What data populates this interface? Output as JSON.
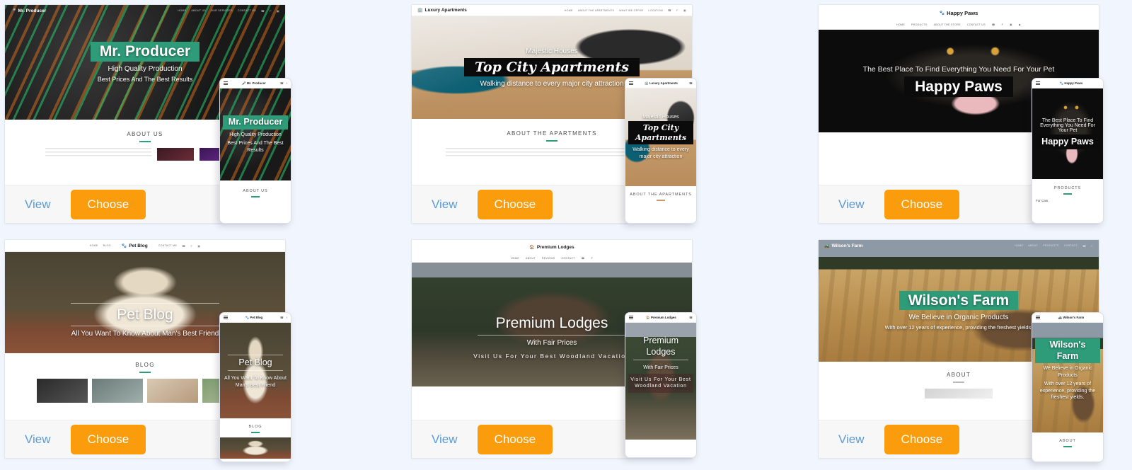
{
  "page": {
    "background": "#f1f5fd",
    "accent": "#fb9c0c",
    "link": "#5b9bd5",
    "brand_green": "#2e9c78"
  },
  "actions": {
    "view_label": "View",
    "choose_label": "Choose"
  },
  "templates": [
    {
      "id": "mr-producer",
      "brand": "Mr. Producer",
      "brand_icon": "microphone-icon",
      "nav": [
        "HOME",
        "ABOUT US",
        "OUR SERVICES",
        "CONTACT US"
      ],
      "social": [
        "phone-icon",
        "facebook-icon",
        "instagram-icon"
      ],
      "hero": {
        "pre": "",
        "title": "Mr. Producer",
        "sub": "High Quality Production",
        "sub2": "Best Prices And The Best Results"
      },
      "section_title": "ABOUT US",
      "phone_section_title": "ABOUT US",
      "phone_footnote": ""
    },
    {
      "id": "luxury-apartments",
      "brand": "Luxury Apartments",
      "brand_icon": "building-icon",
      "nav": [
        "HOME",
        "ABOUT THE APARTMENTS",
        "WHAT WE OFFER",
        "LOCATION"
      ],
      "social": [
        "phone-icon",
        "facebook-icon",
        "instagram-icon"
      ],
      "hero": {
        "pre": "Majestic Houses",
        "title": "Top City Apartments",
        "sub": "Walking distance to every major city attraction",
        "sub2": ""
      },
      "section_title": "ABOUT THE APARTMENTS",
      "phone_section_title": "ABOUT THE APARTMENTS",
      "phone_footnote": ""
    },
    {
      "id": "happy-paws",
      "brand": "Happy Paws",
      "brand_icon": "paw-icon",
      "nav": [
        "HOME",
        "PRODUCTS",
        "ABOUT THE STORE",
        "CONTACT US"
      ],
      "social": [
        "phone-icon",
        "facebook-icon",
        "instagram-icon",
        "twitter-icon"
      ],
      "hero": {
        "pre": "The Best Place To Find Everything You Need For Your Pet",
        "title": "Happy Paws",
        "sub": "",
        "sub2": ""
      },
      "section_title": "PRODUCTS",
      "phone_section_title": "PRODUCTS",
      "phone_footnote": "For Cats"
    },
    {
      "id": "pet-blog",
      "brand": "Pet Blog",
      "brand_icon": "paw-icon",
      "nav": [
        "HOME",
        "BLOG",
        "CONTACT ME"
      ],
      "social": [
        "phone-icon",
        "facebook-icon",
        "instagram-icon"
      ],
      "hero": {
        "pre": "",
        "title": "Pet Blog",
        "sub": "All You Want To Know About Man's Best Friend",
        "sub2": ""
      },
      "section_title": "BLOG",
      "phone_section_title": "BLOG",
      "phone_footnote": ""
    },
    {
      "id": "premium-lodges",
      "brand": "Premium Lodges",
      "brand_icon": "home-icon",
      "nav": [
        "HOME",
        "ABOUT",
        "REVIEWS",
        "CONTACT"
      ],
      "social": [
        "phone-icon",
        "facebook-icon"
      ],
      "hero": {
        "pre": "",
        "title": "Premium Lodges",
        "sub": "With Fair Prices",
        "sub2": "Visit Us For Your Best Woodland Vacation"
      },
      "section_title": "",
      "phone_section_title": "",
      "phone_footnote": ""
    },
    {
      "id": "wilsons-farm",
      "brand": "Wilson's Farm",
      "brand_icon": "tractor-icon",
      "nav": [
        "HOME",
        "ABOUT",
        "PRODUCTS",
        "CONTACT"
      ],
      "social": [
        "phone-icon",
        "facebook-icon"
      ],
      "hero": {
        "pre": "",
        "title": "Wilson's Farm",
        "sub": "We Believe in Organic Products",
        "sub2": "With over 12 years of experience, providing the freshest yields."
      },
      "section_title": "ABOUT",
      "phone_section_title": "ABOUT",
      "phone_footnote": ""
    }
  ]
}
